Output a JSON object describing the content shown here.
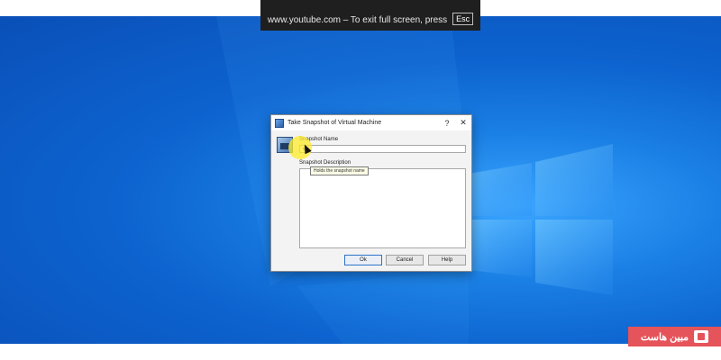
{
  "browser": {
    "fullscreen_notice": "www.youtube.com – To exit full screen, press",
    "esc_key": "Esc"
  },
  "dialog": {
    "title": "Take Snapshot of Virtual Machine",
    "help_glyph": "?",
    "close_glyph": "✕",
    "name_label": "Snapshot Name",
    "name_value": "wi",
    "description_label": "Snapshot Description",
    "tooltip": "Holds the snapshot name",
    "buttons": {
      "ok": "Ok",
      "cancel": "Cancel",
      "help": "Help"
    }
  },
  "watermark": {
    "text": "مبین هاست",
    "icon": "mobinhost-logo-icon"
  },
  "colors": {
    "desktop_blue": "#0d63cf",
    "watermark_red": "#e5545a",
    "highlight_yellow": "#ffeb28"
  }
}
